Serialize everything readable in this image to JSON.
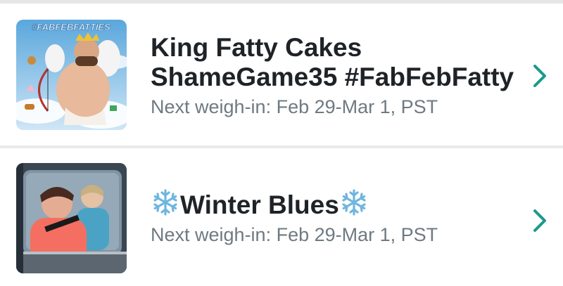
{
  "groups": [
    {
      "title_line1": "King Fatty Cakes",
      "title_line2": "ShameGame35 #FabFebFatty",
      "next_weigh_in": "Next weigh-in: Feb 29-Mar 1, PST",
      "thumbnail_text": "#FABFEBFATTIES"
    },
    {
      "title": "Winter Blues",
      "next_weigh_in": "Next weigh-in: Feb 29-Mar 1, PST"
    }
  ],
  "colors": {
    "accent": "#1a9a8d",
    "title_text": "#1f2327",
    "subtitle_text": "#6e7a82",
    "divider": "#e4e6e8",
    "snowflake": "#6fb6df"
  },
  "icons": {
    "chevron": "chevron-right-icon",
    "snowflake": "snowflake-icon"
  }
}
